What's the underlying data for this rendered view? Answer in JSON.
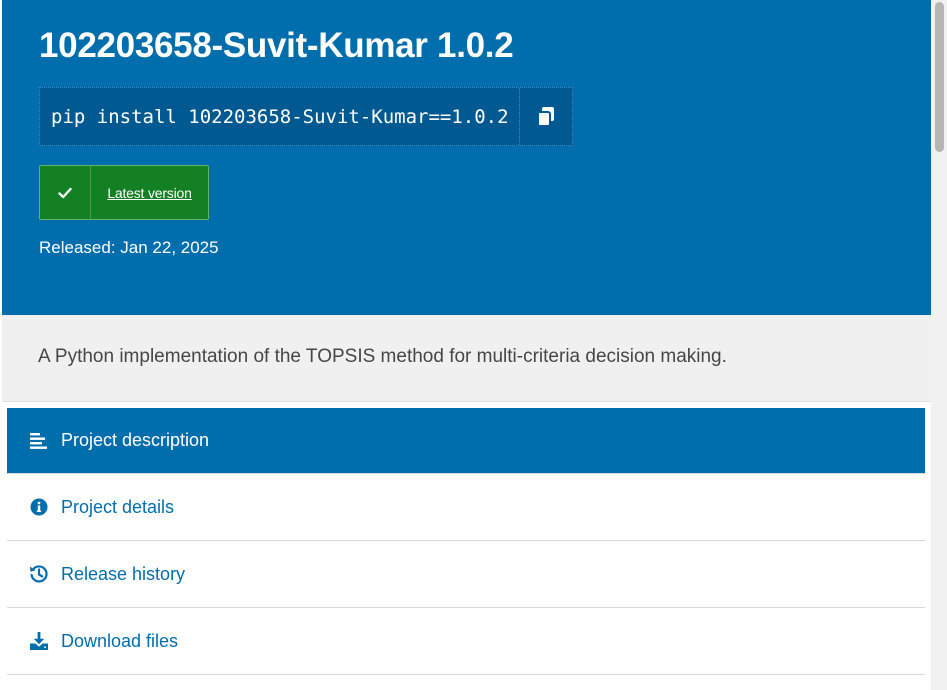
{
  "header": {
    "title": "102203658-Suvit-Kumar 1.0.2",
    "pip_command": "pip install 102203658-Suvit-Kumar==1.0.2",
    "copy_icon": "copy-icon",
    "version_badge": {
      "icon": "check-icon",
      "label": "Latest version"
    },
    "released": "Released: Jan 22, 2025"
  },
  "summary": {
    "text": "A Python implementation of the TOPSIS method for multi-criteria decision making."
  },
  "nav": {
    "items": [
      {
        "label": "Project description",
        "icon": "align-left-icon",
        "active": true
      },
      {
        "label": "Project details",
        "icon": "info-circle-icon",
        "active": false
      },
      {
        "label": "Release history",
        "icon": "history-icon",
        "active": false
      },
      {
        "label": "Download files",
        "icon": "download-icon",
        "active": false
      }
    ]
  },
  "colors": {
    "brand_blue": "#006dad",
    "badge_green": "#148024",
    "summary_bg": "#f0f0f0"
  }
}
